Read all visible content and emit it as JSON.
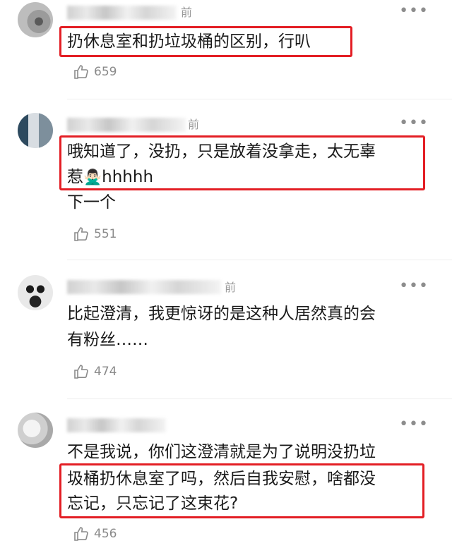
{
  "comments": [
    {
      "time": "前",
      "text": "扔休息室和扔垃圾桶的区别，行叭",
      "likes": "659"
    },
    {
      "time": "前",
      "text_line1": "哦知道了，没扔，只是放着没拿走，太无辜",
      "text_line2_a": "惹",
      "emoji": "🙅🏻‍♂️",
      "text_line2_b": "hhhhh",
      "text_line3": "下一个",
      "likes": "551"
    },
    {
      "time": "前",
      "text_line1": "比起澄清，我更惊讶的是这种人居然真的会",
      "text_line2": "有粉丝……",
      "likes": "474"
    },
    {
      "time": "",
      "text_line1": "不是我说，你们这澄清就是为了说明没扔垃",
      "text_line2": "圾桶扔休息室了吗，然后自我安慰，啥都没",
      "text_line3": "忘记，只忘记了这束花?",
      "likes": "456"
    }
  ],
  "icons": {
    "more": "more-dots-icon",
    "like": "thumbs-up-icon"
  },
  "colors": {
    "highlight": "#e31e24",
    "meta": "#9a9a9a"
  }
}
